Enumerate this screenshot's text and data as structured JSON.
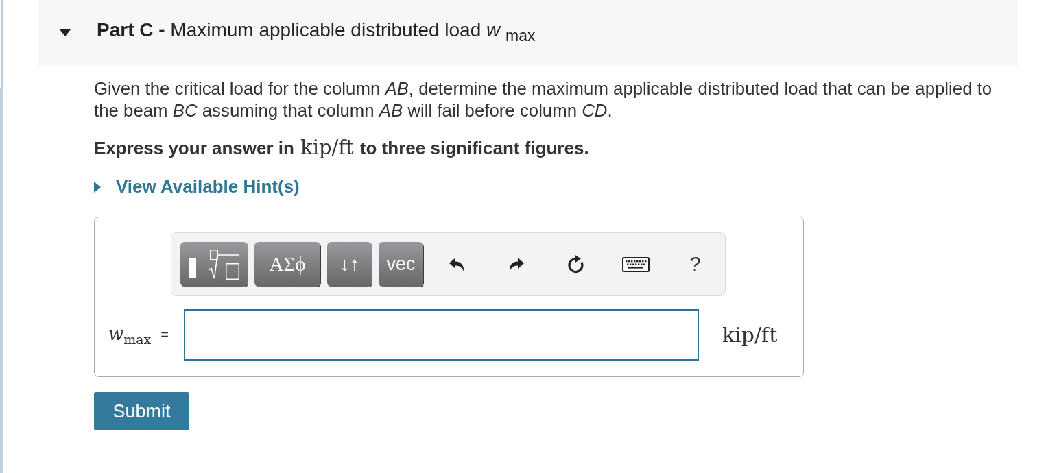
{
  "part": {
    "expanded": true,
    "title": "**Part C -** Maximum applicable distributed load *w* $_{max}$"
  },
  "question": {
    "text": "Given the critical load for the column *AB*, determine the maximum applicable distributed load that can be applied to the beam *BC* assuming that column *AB* will fail before column *CD*.",
    "instruction": "**Express your answer in** kip/ft **to three significant figures.**"
  },
  "hint": {
    "label": "View Available Hint(s)",
    "expanded": false
  },
  "answer": {
    "toolbar": [
      {
        "kind": "template"
      },
      {
        "kind": "symbols",
        "label": "ΑΣϕ"
      },
      {
        "kind": "arrows",
        "label": "↓↑"
      },
      {
        "kind": "vector",
        "label": "vec"
      },
      {
        "kind": "undo"
      },
      {
        "kind": "redo"
      },
      {
        "kind": "reset"
      },
      {
        "kind": "keyboard"
      },
      {
        "kind": "help",
        "label": "?"
      }
    ],
    "label": "*w*$_{max}$",
    "equals": "=",
    "units": "kip/ft"
  },
  "submit": {
    "label": "Submit"
  }
}
